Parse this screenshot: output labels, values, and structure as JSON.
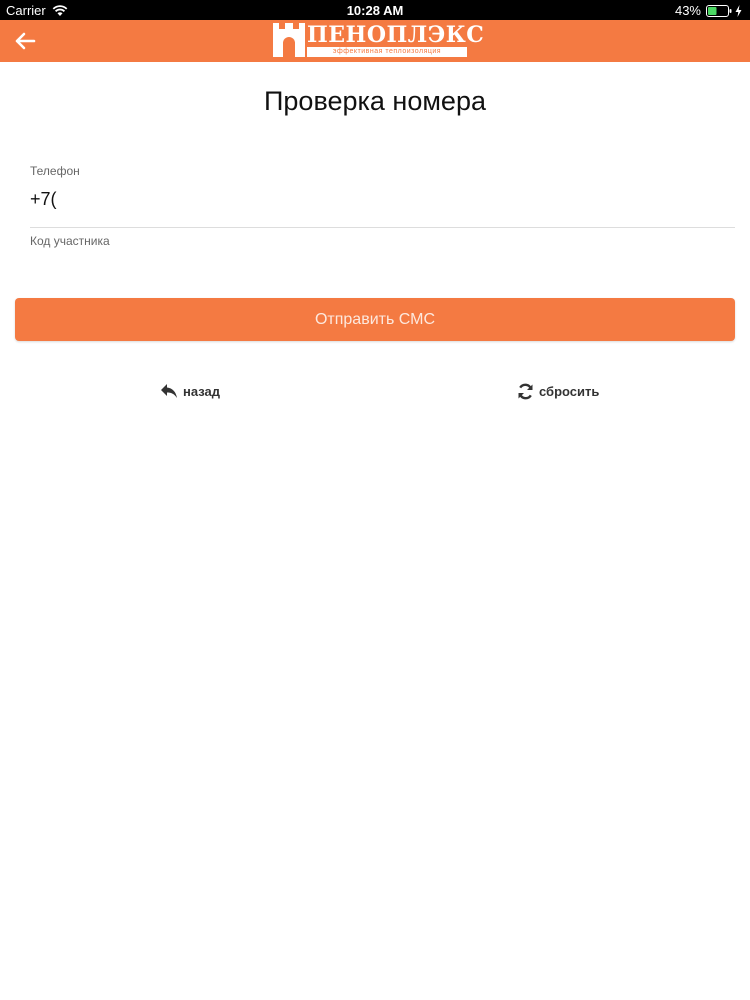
{
  "status_bar": {
    "carrier": "Carrier",
    "time": "10:28 AM",
    "battery": "43%",
    "icons": [
      "wifi-icon",
      "battery-icon",
      "charging-icon"
    ]
  },
  "header": {
    "back_icon": "arrow-left-icon",
    "logo_text": "ПЕНОПЛЭКС",
    "logo_slogan": "эффективная теплоизоляция",
    "background_color": "#f47a42"
  },
  "page": {
    "title": "Проверка номера"
  },
  "form": {
    "phone_label": "Телефон",
    "phone_value": "+7(",
    "code_label": "Код участника",
    "code_value": ""
  },
  "actions": {
    "send_sms_label": "Отправить СМС",
    "back_label": "назад",
    "back_icon": "reply-icon",
    "reset_label": "сбросить",
    "reset_icon": "refresh-icon"
  },
  "colors": {
    "accent": "#f47a42"
  }
}
